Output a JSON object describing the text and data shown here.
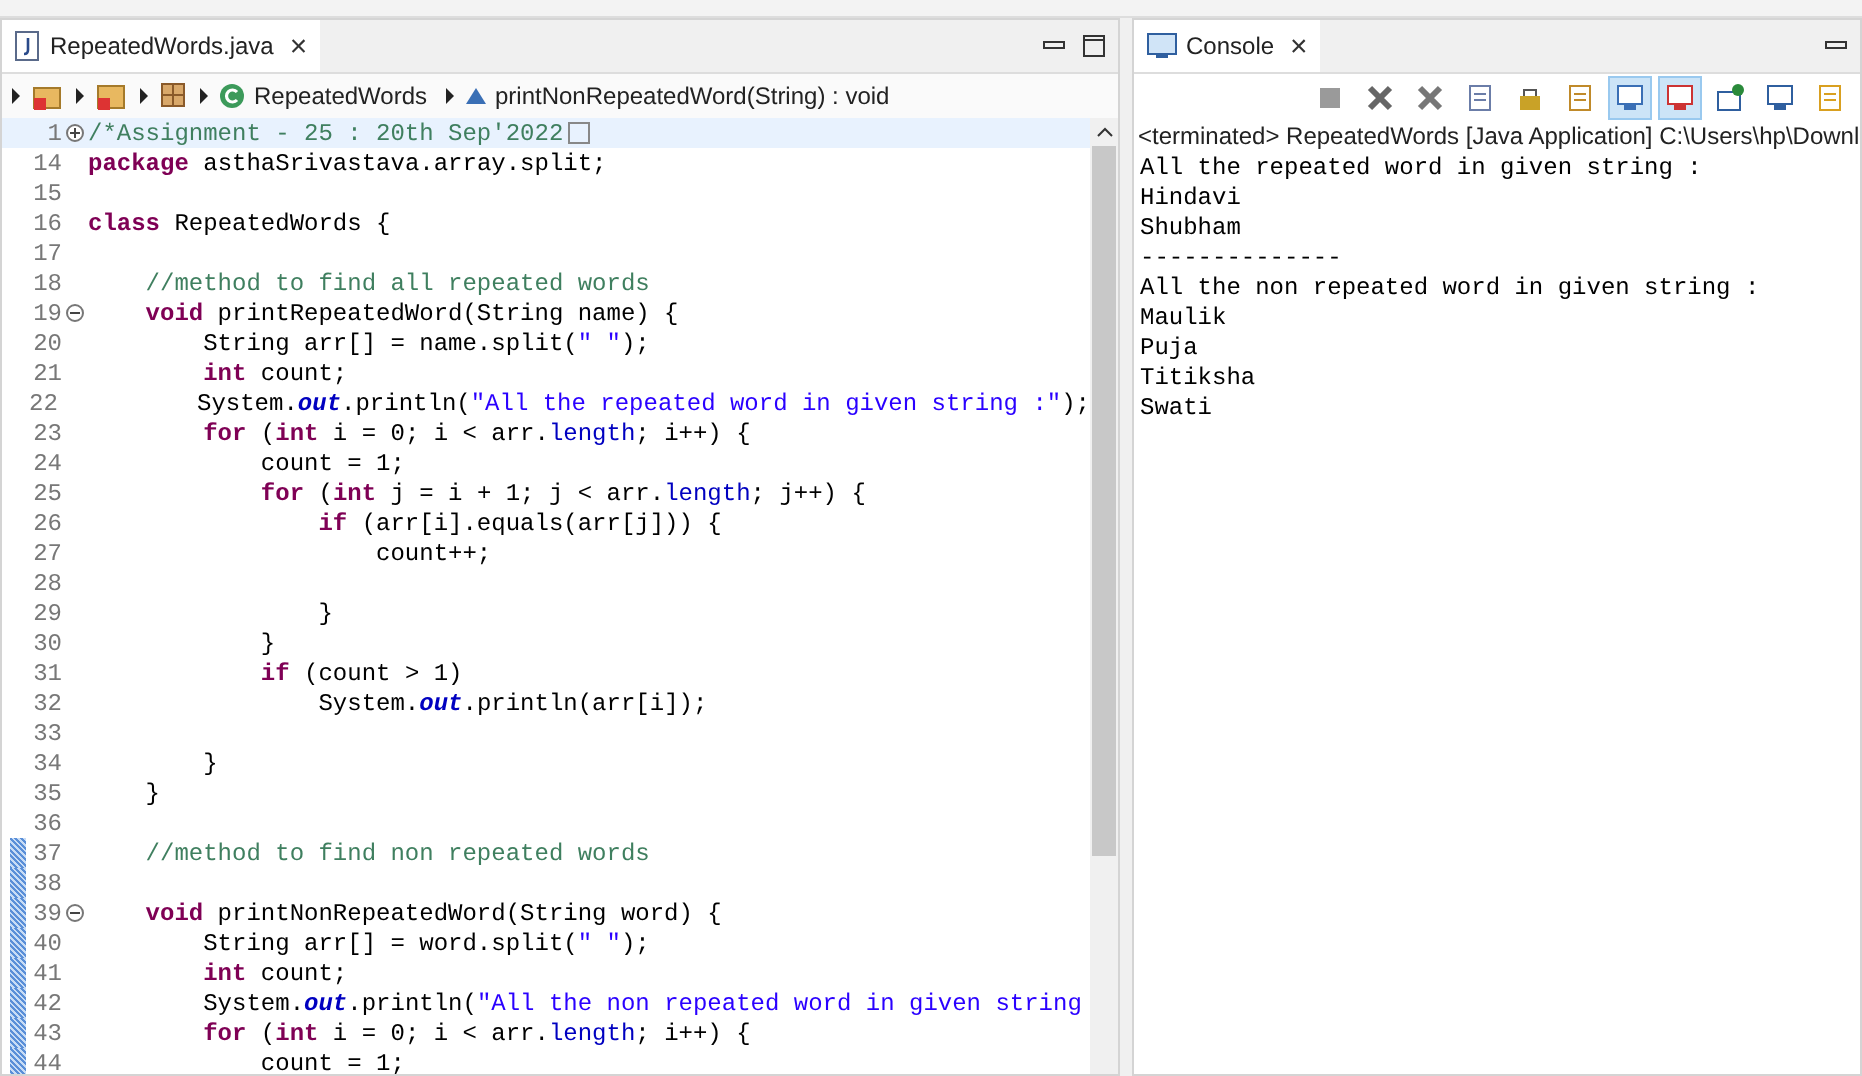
{
  "editor": {
    "tab": {
      "title": "RepeatedWords.java",
      "close": "×"
    },
    "breadcrumb": [
      {
        "kind": "project"
      },
      {
        "kind": "source-folder"
      },
      {
        "kind": "package"
      },
      {
        "kind": "class",
        "label": "RepeatedWords"
      },
      {
        "kind": "method",
        "label": "printNonRepeatedWord(String) : void"
      }
    ],
    "lines": [
      {
        "number": "1",
        "kind": "fold-expand",
        "current": true,
        "changed": false,
        "tokens": [
          {
            "kind": "comment",
            "text": "/*Assignment - 25 : 20th Sep'2022"
          }
        ]
      },
      {
        "number": "14",
        "kind": "plain",
        "current": false,
        "changed": false,
        "tokens": [
          {
            "kind": "keyword",
            "text": "package"
          },
          {
            "kind": "plain",
            "text": " asthaSrivastava.array.split;"
          }
        ]
      },
      {
        "number": "15",
        "kind": "plain",
        "current": false,
        "changed": false
      },
      {
        "number": "16",
        "kind": "plain",
        "current": false,
        "changed": false,
        "tokens": [
          {
            "kind": "keyword",
            "text": "class"
          },
          {
            "kind": "plain",
            "text": " RepeatedWords {"
          }
        ]
      },
      {
        "number": "17",
        "kind": "plain",
        "current": false,
        "changed": false
      },
      {
        "number": "18",
        "kind": "plain",
        "current": false,
        "changed": false,
        "tokens": [
          {
            "kind": "comment",
            "text": "    //method to find all repeated words"
          }
        ]
      },
      {
        "number": "19",
        "kind": "fold-collapse",
        "current": false,
        "changed": false,
        "tokens": [
          {
            "kind": "keyword",
            "text": "    void"
          },
          {
            "kind": "plain",
            "text": " printRepeatedWord(String name) {"
          }
        ]
      },
      {
        "number": "20",
        "kind": "plain",
        "current": false,
        "changed": false,
        "tokens": [
          {
            "kind": "plain",
            "text": "        String arr[] = name.split("
          },
          {
            "kind": "string",
            "text": "\" \""
          },
          {
            "kind": "plain",
            "text": ");"
          }
        ]
      },
      {
        "number": "21",
        "kind": "plain",
        "current": false,
        "changed": false,
        "tokens": [
          {
            "kind": "keyword",
            "text": "        int"
          },
          {
            "kind": "plain",
            "text": " count;"
          }
        ]
      },
      {
        "number": "22",
        "kind": "plain",
        "current": false,
        "changed": false,
        "tokens": [
          {
            "kind": "plain",
            "text": "        System."
          },
          {
            "kind": "static",
            "text": "out"
          },
          {
            "kind": "plain",
            "text": ".println("
          },
          {
            "kind": "string",
            "text": "\"All the repeated word in given string :\""
          },
          {
            "kind": "plain",
            "text": ");"
          }
        ]
      },
      {
        "number": "23",
        "kind": "plain",
        "current": false,
        "changed": false,
        "tokens": [
          {
            "kind": "keyword",
            "text": "        for"
          },
          {
            "kind": "plain",
            "text": " ("
          },
          {
            "kind": "keyword",
            "text": "int"
          },
          {
            "kind": "plain",
            "text": " i = 0; i < arr."
          },
          {
            "kind": "field",
            "text": "length"
          },
          {
            "kind": "plain",
            "text": "; i++) {"
          }
        ]
      },
      {
        "number": "24",
        "kind": "plain",
        "current": false,
        "changed": false,
        "tokens": [
          {
            "kind": "plain",
            "text": "            count = 1;"
          }
        ]
      },
      {
        "number": "25",
        "kind": "plain",
        "current": false,
        "changed": false,
        "tokens": [
          {
            "kind": "keyword",
            "text": "            for"
          },
          {
            "kind": "plain",
            "text": " ("
          },
          {
            "kind": "keyword",
            "text": "int"
          },
          {
            "kind": "plain",
            "text": " j = i + 1; j < arr."
          },
          {
            "kind": "field",
            "text": "length"
          },
          {
            "kind": "plain",
            "text": "; j++) {"
          }
        ]
      },
      {
        "number": "26",
        "kind": "plain",
        "current": false,
        "changed": false,
        "tokens": [
          {
            "kind": "keyword",
            "text": "                if"
          },
          {
            "kind": "plain",
            "text": " (arr[i].equals(arr[j])) {"
          }
        ]
      },
      {
        "number": "27",
        "kind": "plain",
        "current": false,
        "changed": false,
        "tokens": [
          {
            "kind": "plain",
            "text": "                    count++;"
          }
        ]
      },
      {
        "number": "28",
        "kind": "plain",
        "current": false,
        "changed": false
      },
      {
        "number": "29",
        "kind": "plain",
        "current": false,
        "changed": false,
        "tokens": [
          {
            "kind": "plain",
            "text": "                }"
          }
        ]
      },
      {
        "number": "30",
        "kind": "plain",
        "current": false,
        "changed": false,
        "tokens": [
          {
            "kind": "plain",
            "text": "            }"
          }
        ]
      },
      {
        "number": "31",
        "kind": "plain",
        "current": false,
        "changed": false,
        "tokens": [
          {
            "kind": "keyword",
            "text": "            if"
          },
          {
            "kind": "plain",
            "text": " (count > 1)"
          }
        ]
      },
      {
        "number": "32",
        "kind": "plain",
        "current": false,
        "changed": false,
        "tokens": [
          {
            "kind": "plain",
            "text": "                System."
          },
          {
            "kind": "static",
            "text": "out"
          },
          {
            "kind": "plain",
            "text": ".println(arr[i]);"
          }
        ]
      },
      {
        "number": "33",
        "kind": "plain",
        "current": false,
        "changed": false
      },
      {
        "number": "34",
        "kind": "plain",
        "current": false,
        "changed": false,
        "tokens": [
          {
            "kind": "plain",
            "text": "        }"
          }
        ]
      },
      {
        "number": "35",
        "kind": "plain",
        "current": false,
        "changed": false,
        "tokens": [
          {
            "kind": "plain",
            "text": "    }"
          }
        ]
      },
      {
        "number": "36",
        "kind": "plain",
        "current": false,
        "changed": false
      },
      {
        "number": "37",
        "kind": "plain",
        "current": false,
        "changed": true,
        "tokens": [
          {
            "kind": "comment",
            "text": "    //method to find non repeated words"
          }
        ]
      },
      {
        "number": "38",
        "kind": "plain",
        "current": false,
        "changed": true
      },
      {
        "number": "39",
        "kind": "fold-collapse",
        "current": false,
        "changed": true,
        "tokens": [
          {
            "kind": "keyword",
            "text": "    void"
          },
          {
            "kind": "plain",
            "text": " printNonRepeatedWord(String word) {"
          }
        ]
      },
      {
        "number": "40",
        "kind": "plain",
        "current": false,
        "changed": true,
        "tokens": [
          {
            "kind": "plain",
            "text": "        String arr[] = word.split("
          },
          {
            "kind": "string",
            "text": "\" \""
          },
          {
            "kind": "plain",
            "text": ");"
          }
        ]
      },
      {
        "number": "41",
        "kind": "plain",
        "current": false,
        "changed": true,
        "tokens": [
          {
            "kind": "keyword",
            "text": "        int"
          },
          {
            "kind": "plain",
            "text": " count;"
          }
        ]
      },
      {
        "number": "42",
        "kind": "plain",
        "current": false,
        "changed": true,
        "tokens": [
          {
            "kind": "plain",
            "text": "        System."
          },
          {
            "kind": "static",
            "text": "out"
          },
          {
            "kind": "plain",
            "text": ".println("
          },
          {
            "kind": "string",
            "text": "\"All the non repeated word in given string"
          }
        ]
      },
      {
        "number": "43",
        "kind": "plain",
        "current": false,
        "changed": true,
        "tokens": [
          {
            "kind": "keyword",
            "text": "        for"
          },
          {
            "kind": "plain",
            "text": " ("
          },
          {
            "kind": "keyword",
            "text": "int"
          },
          {
            "kind": "plain",
            "text": " i = 0; i < arr."
          },
          {
            "kind": "field",
            "text": "length"
          },
          {
            "kind": "plain",
            "text": "; i++) {"
          }
        ]
      },
      {
        "number": "44",
        "kind": "plain",
        "current": false,
        "changed": true,
        "tokens": [
          {
            "kind": "plain",
            "text": "            count = 1;"
          }
        ]
      }
    ]
  },
  "console": {
    "tab": {
      "title": "Console",
      "close": "×"
    },
    "toolbar": [
      {
        "kind": "stop",
        "on": false
      },
      {
        "kind": "remove",
        "on": false
      },
      {
        "kind": "remove-all",
        "on": false
      },
      {
        "kind": "clear",
        "on": false
      },
      {
        "kind": "lock",
        "on": false
      },
      {
        "kind": "wrap",
        "on": false
      },
      {
        "kind": "show-out",
        "on": true
      },
      {
        "kind": "show-err",
        "on": true
      },
      {
        "kind": "pin",
        "on": false
      },
      {
        "kind": "display",
        "on": false
      },
      {
        "kind": "new",
        "on": false
      }
    ],
    "status": "<terminated> RepeatedWords [Java Application] C:\\Users\\hp\\Downl",
    "output": [
      "All the repeated word in given string :",
      "Hindavi",
      "Shubham",
      "--------------",
      "All the non repeated word in given string :",
      "Maulik",
      "Puja",
      "Titiksha",
      "Swati"
    ]
  }
}
